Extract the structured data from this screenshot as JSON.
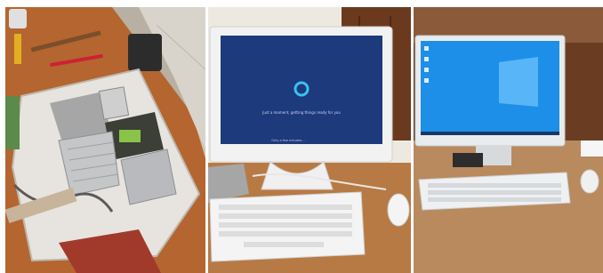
{
  "collage": {
    "panels": [
      {
        "subject": "disassembled-all-in-one-computer"
      },
      {
        "subject": "all-in-one-computer-booting-setup-screen"
      },
      {
        "subject": "all-in-one-computer-windows-desktop"
      }
    ],
    "panel2_screen": {
      "setup_line": "Just a moment, getting things ready for you",
      "bottom_line": "Only a few minutes..."
    }
  }
}
